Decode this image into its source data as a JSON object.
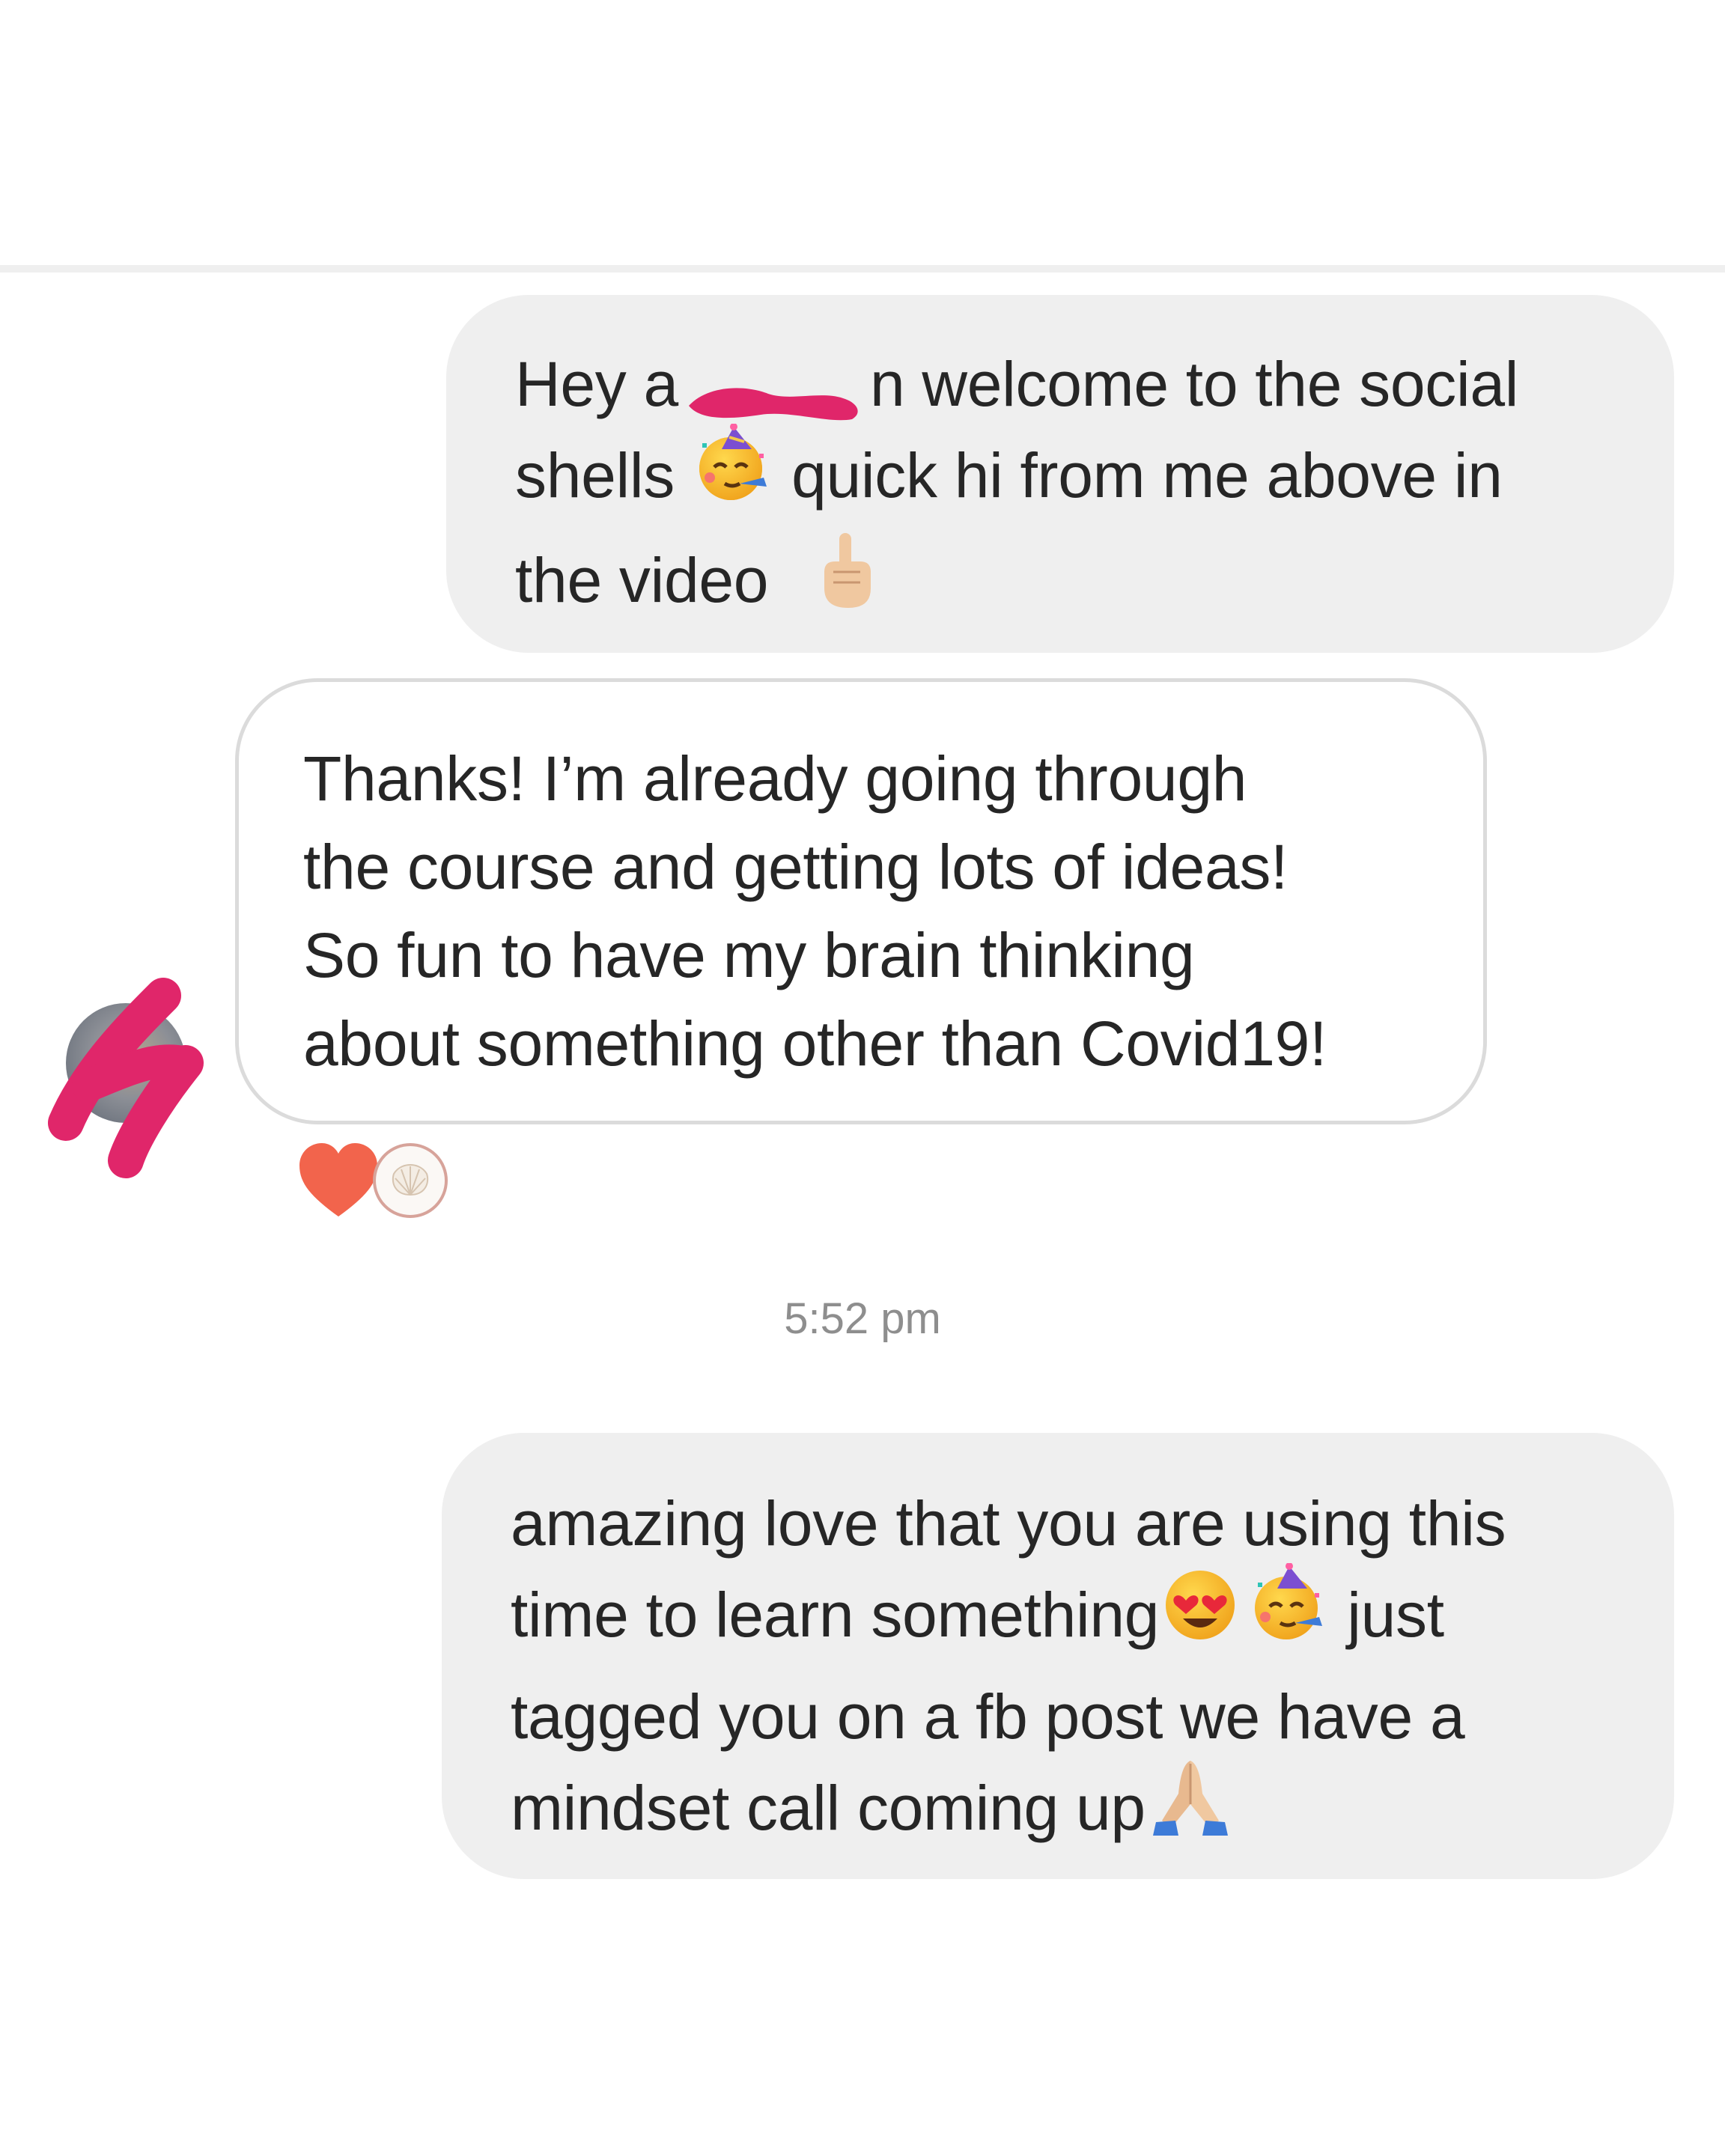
{
  "thread": {
    "messages": [
      {
        "sender": "me",
        "lines": [
          {
            "before": "Hey a",
            "after": "n welcome to the social"
          },
          {
            "text": "shells",
            "text2": "quick hi from me above in"
          },
          {
            "text": "the video"
          }
        ],
        "emojis": [
          "partying-face",
          "index-pointing-up-emoji"
        ]
      },
      {
        "sender": "them",
        "lines": [
          "Thanks! I’m already going through",
          "the course and getting lots of ideas!",
          "So fun to have my brain thinking",
          "about something other than Covid19!"
        ],
        "reactions": [
          "heart",
          "shell-logo-avatar"
        ]
      },
      {
        "sender": "me",
        "lines": [
          {
            "text": "amazing love that you are using this"
          },
          {
            "text": "time to learn something",
            "text2": "just"
          },
          {
            "text": "tagged you on a fb post we have a"
          },
          {
            "text": "mindset call coming up"
          }
        ],
        "emojis": [
          "heart-eyes-face",
          "partying-face",
          "folded-hands"
        ]
      }
    ],
    "timestamp": "5:52 pm"
  },
  "colors": {
    "outgoing_bubble": "#efefef",
    "incoming_border": "#dbdbdb",
    "redaction_pink": "#e0266a",
    "heart_reaction": "#f2644c",
    "timestamp_gray": "#8e8e8e"
  },
  "icons": [
    "heart-icon",
    "partying-face-icon",
    "pointing-up-icon",
    "heart-eyes-icon",
    "folded-hands-icon",
    "shell-icon"
  ]
}
